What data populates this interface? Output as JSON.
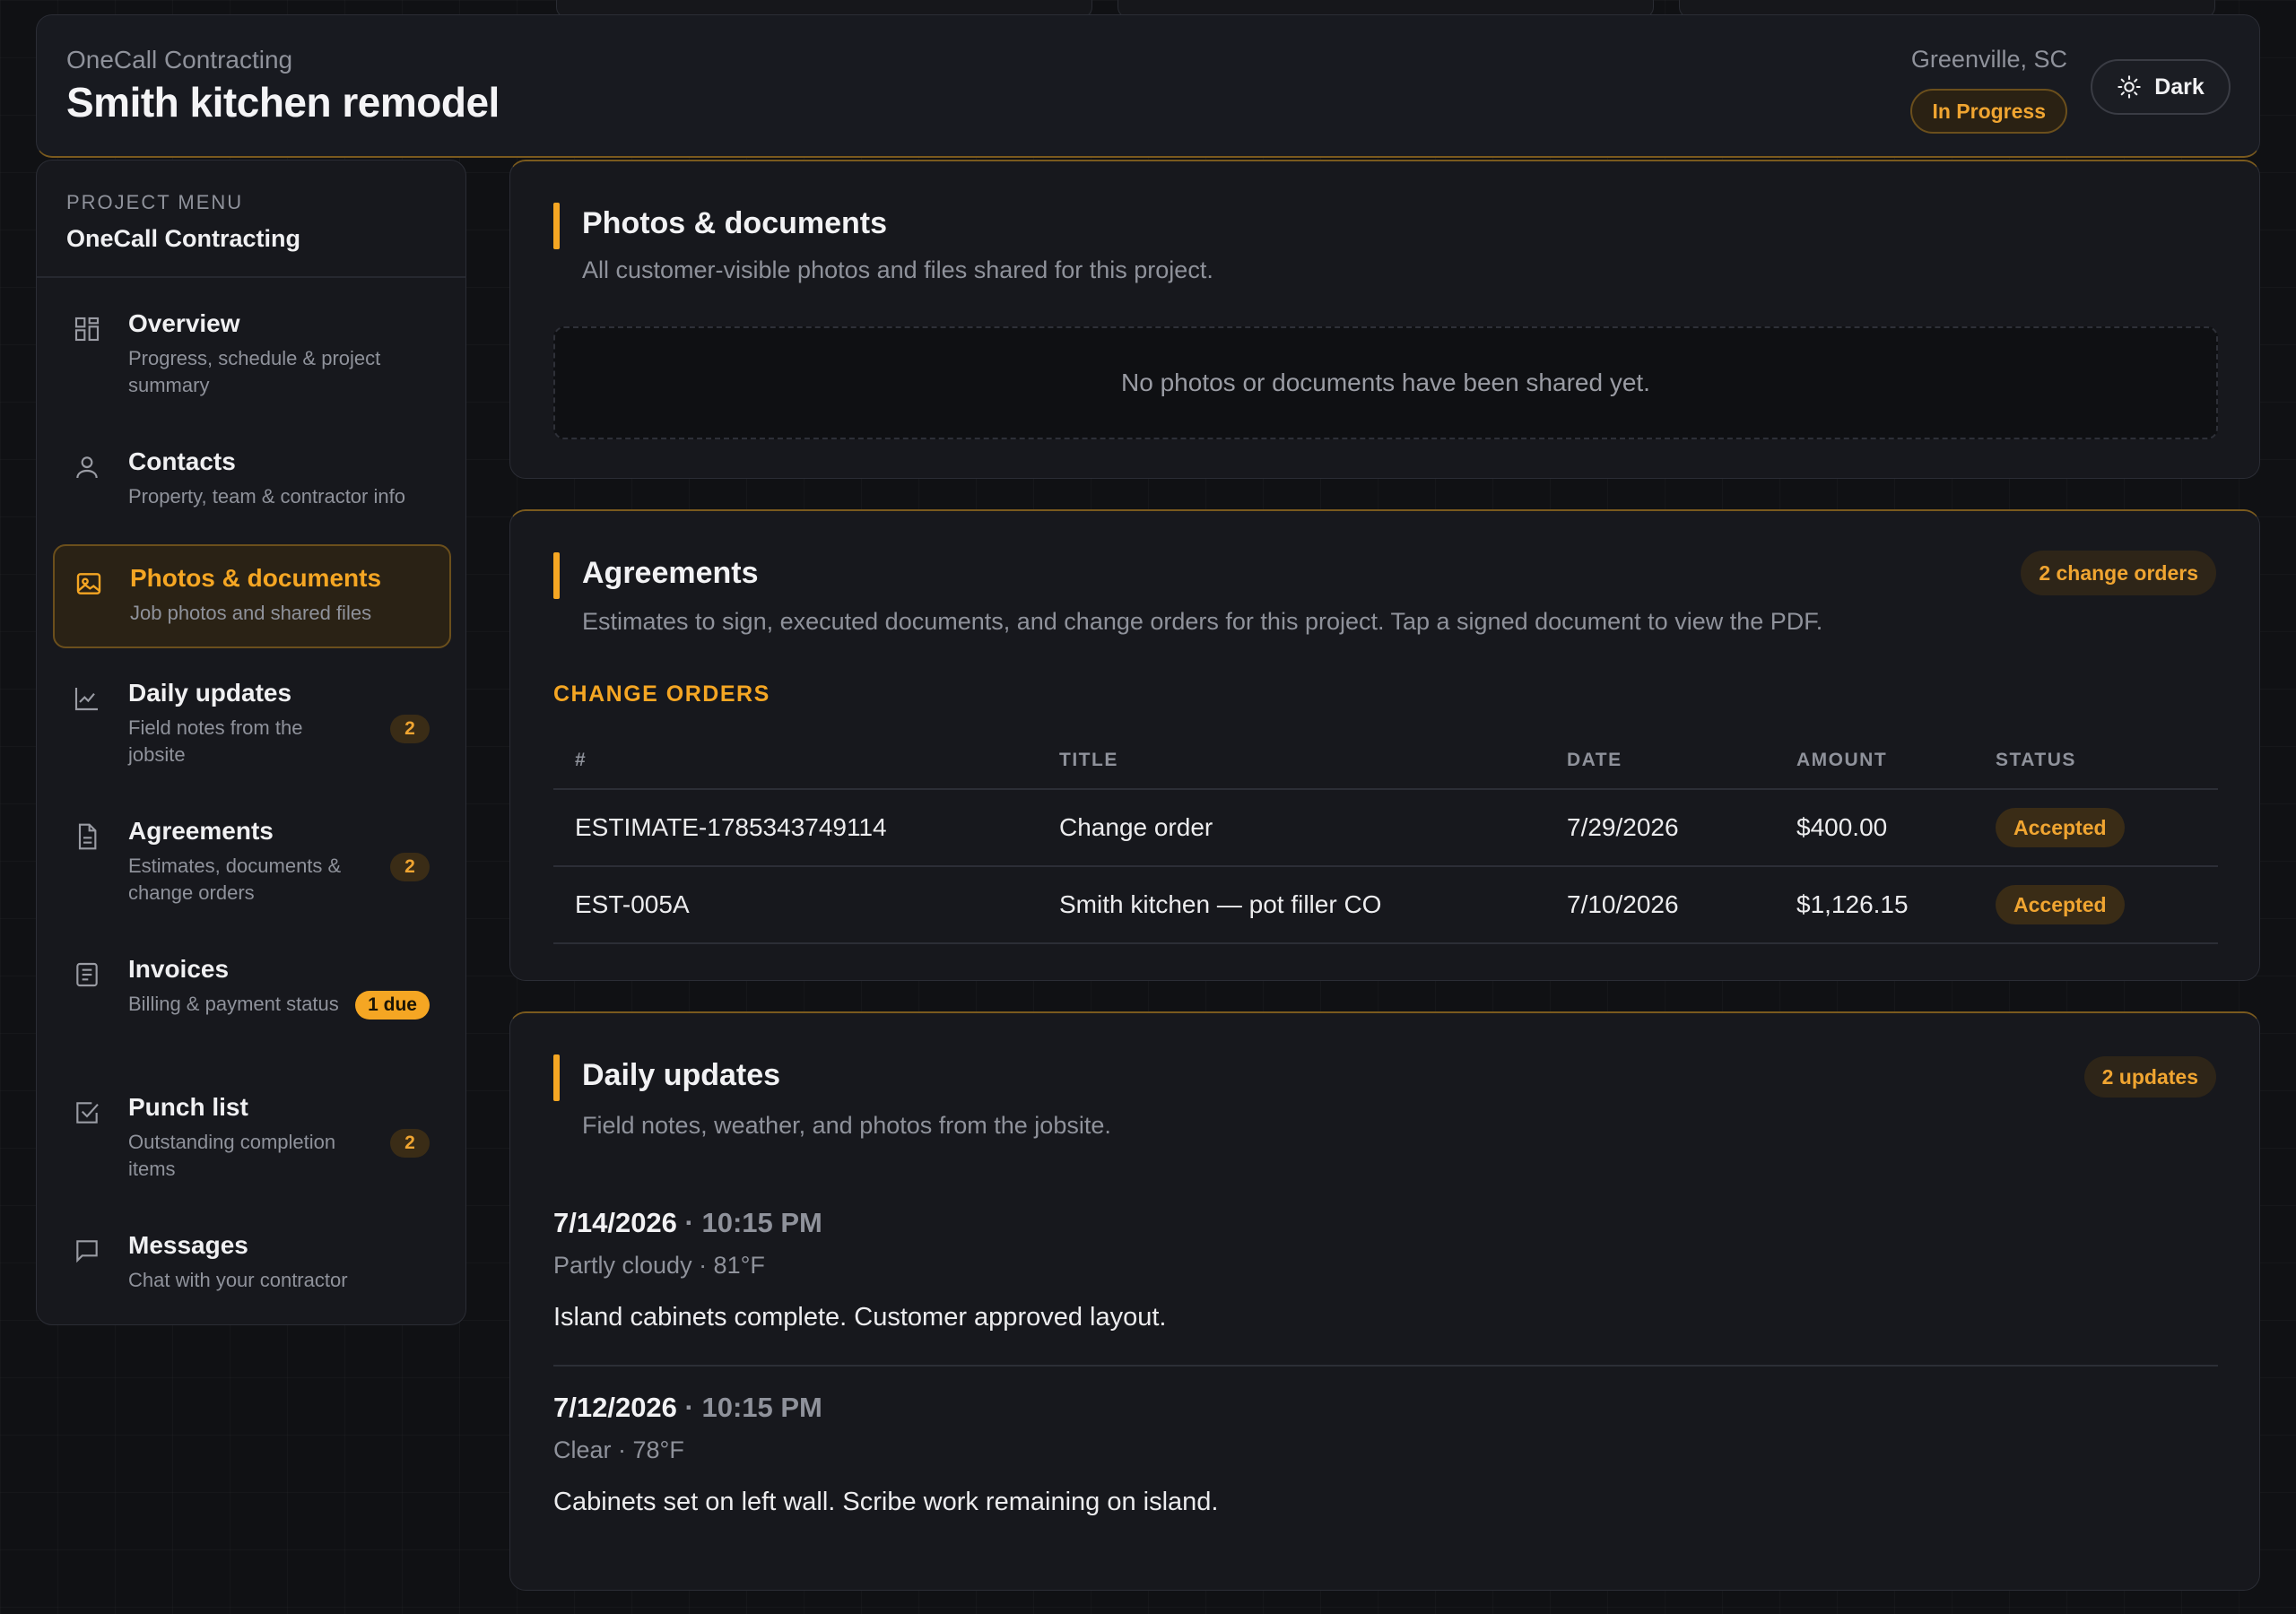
{
  "header": {
    "company": "OneCall Contracting",
    "title": "Smith kitchen remodel",
    "location": "Greenville, SC",
    "status": "In Progress",
    "theme_label": "Dark"
  },
  "sidebar": {
    "menu_label": "PROJECT MENU",
    "company": "OneCall Contracting",
    "items": [
      {
        "icon": "grid-icon",
        "title": "Overview",
        "sub": "Progress, schedule & project summary",
        "badge": ""
      },
      {
        "icon": "person-icon",
        "title": "Contacts",
        "sub": "Property, team & contractor info",
        "badge": ""
      },
      {
        "icon": "image-icon",
        "title": "Photos & documents",
        "sub": "Job photos and shared files",
        "badge": ""
      },
      {
        "icon": "chart-icon",
        "title": "Daily updates",
        "sub": "Field notes from the jobsite",
        "badge": "2"
      },
      {
        "icon": "document-icon",
        "title": "Agreements",
        "sub": "Estimates, documents & change orders",
        "badge": "2"
      },
      {
        "icon": "invoice-icon",
        "title": "Invoices",
        "sub": "Billing & payment status",
        "badge": "1 due"
      },
      {
        "icon": "checkbox-icon",
        "title": "Punch list",
        "sub": "Outstanding completion items",
        "badge": "2"
      },
      {
        "icon": "chat-icon",
        "title": "Messages",
        "sub": "Chat with your contractor",
        "badge": ""
      }
    ]
  },
  "photos": {
    "title": "Photos & documents",
    "sub": "All customer-visible photos and files shared for this project.",
    "empty": "No photos or documents have been shared yet."
  },
  "agreements": {
    "title": "Agreements",
    "badge": "2 change orders",
    "sub": "Estimates to sign, executed documents, and change orders for this project. Tap a signed document to view the PDF.",
    "section": "CHANGE ORDERS",
    "columns": [
      "#",
      "TITLE",
      "DATE",
      "AMOUNT",
      "STATUS"
    ],
    "rows": [
      {
        "num": "ESTIMATE-1785343749114",
        "title": "Change order",
        "date": "7/29/2026",
        "amount": "$400.00",
        "status": "Accepted"
      },
      {
        "num": "EST-005A",
        "title": "Smith kitchen — pot filler CO",
        "date": "7/10/2026",
        "amount": "$1,126.15",
        "status": "Accepted"
      }
    ]
  },
  "updates": {
    "title": "Daily updates",
    "badge": "2 updates",
    "sub": "Field notes, weather, and photos from the jobsite.",
    "items": [
      {
        "date": "7/14/2026",
        "time": "· 10:15 PM",
        "weather": "Partly cloudy · 81°F",
        "note": "Island cabinets complete. Customer approved layout."
      },
      {
        "date": "7/12/2026",
        "time": "· 10:15 PM",
        "weather": "Clear · 78°F",
        "note": "Cabinets set on left wall. Scribe work remaining on island."
      }
    ]
  },
  "colors": {
    "accent": "#f5a623",
    "background": "#101114",
    "panel": "#17181d"
  }
}
